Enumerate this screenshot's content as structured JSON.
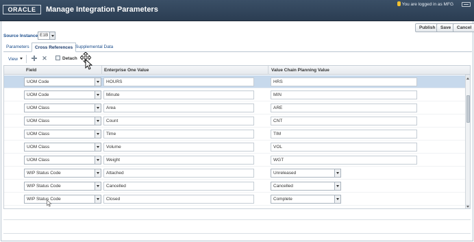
{
  "header": {
    "logo": "ORACLE",
    "title": "Manage Integration Parameters",
    "user_text": "You are logged in as MFG"
  },
  "actions": {
    "publish": "Publish",
    "save": "Save",
    "cancel": "Cancel"
  },
  "source_instance": {
    "label": "Source Instance",
    "value": "E1B"
  },
  "tabs": [
    {
      "label": "Parameters"
    },
    {
      "label": "Cross References"
    },
    {
      "label": "Supplemental Data"
    }
  ],
  "toolbar": {
    "view": "View",
    "detach": "Detach"
  },
  "table": {
    "columns": [
      "Field",
      "Enterprise One Value",
      "Value Chain Planning Value"
    ],
    "rows": [
      {
        "field": "UOM Code",
        "e1": "HOURS",
        "vcp": "HRS"
      },
      {
        "field": "UOM Code",
        "e1": "Minute",
        "vcp": "MIN"
      },
      {
        "field": "UOM Class",
        "e1": "Area",
        "vcp": "ARE"
      },
      {
        "field": "UOM Class",
        "e1": "Count",
        "vcp": "CNT"
      },
      {
        "field": "UOM Class",
        "e1": "Time",
        "vcp": "TIM"
      },
      {
        "field": "UOM Class",
        "e1": "Volume",
        "vcp": "VOL"
      },
      {
        "field": "UOM Class",
        "e1": "Weight",
        "vcp": "WGT"
      },
      {
        "field": "WIP Status Code",
        "e1": "Attached",
        "vcp": "Unreleased"
      },
      {
        "field": "WIP Status Code",
        "e1": "Cancelled",
        "vcp": "Cancelled"
      },
      {
        "field": "WIP Status Code",
        "e1": "Closed",
        "vcp": "Complete"
      }
    ]
  },
  "colors": {
    "header_bg": "#2f4359",
    "selected_row": "#c7d9ec",
    "link_blue": "#1a4d8c"
  }
}
